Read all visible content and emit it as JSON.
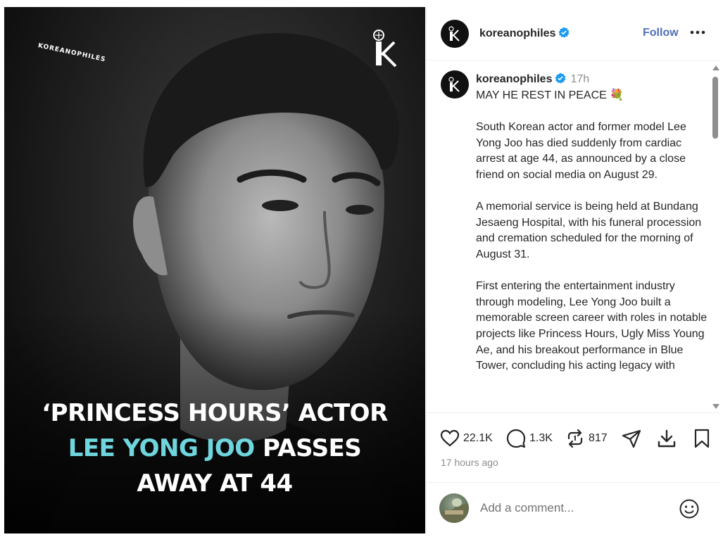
{
  "media": {
    "brand_text": "KOREANOPHILES",
    "headline_line1": "‘PRINCESS HOURS’ ACTOR",
    "headline_line2_accent": "LEE YONG JOO",
    "headline_line2_rest": " PASSES",
    "headline_line3": "AWAY AT 44",
    "accent_color": "#6fd6de"
  },
  "header": {
    "username": "koreanophiles",
    "follow_label": "Follow",
    "more_icon": "more-horizontal-icon"
  },
  "caption": {
    "username": "koreanophiles",
    "time": "17h",
    "line_title": "MAY HE REST IN PEACE 💐",
    "body": "South Korean actor and former model Lee Yong Joo has died suddenly from cardiac arrest at age 44, as announced by a close friend on social media on August 29.\n\nA memorial service is being held at Bundang Jesaeng Hospital, with his funeral procession and cremation scheduled for the morning of August 31.\n\nFirst entering the entertainment industry through modeling, Lee Yong Joo built a memorable screen career with roles in notable projects like Princess Hours, Ugly Miss Young Ae, and his breakout performance in Blue Tower, concluding his acting legacy with"
  },
  "actions": {
    "likes": "22.1K",
    "comments": "1.3K",
    "reposts": "817"
  },
  "post_age": "17 hours ago",
  "comment": {
    "placeholder": "Add a comment..."
  },
  "colors": {
    "follow": "#4f6fb8",
    "verified": "#1d9bf0"
  }
}
